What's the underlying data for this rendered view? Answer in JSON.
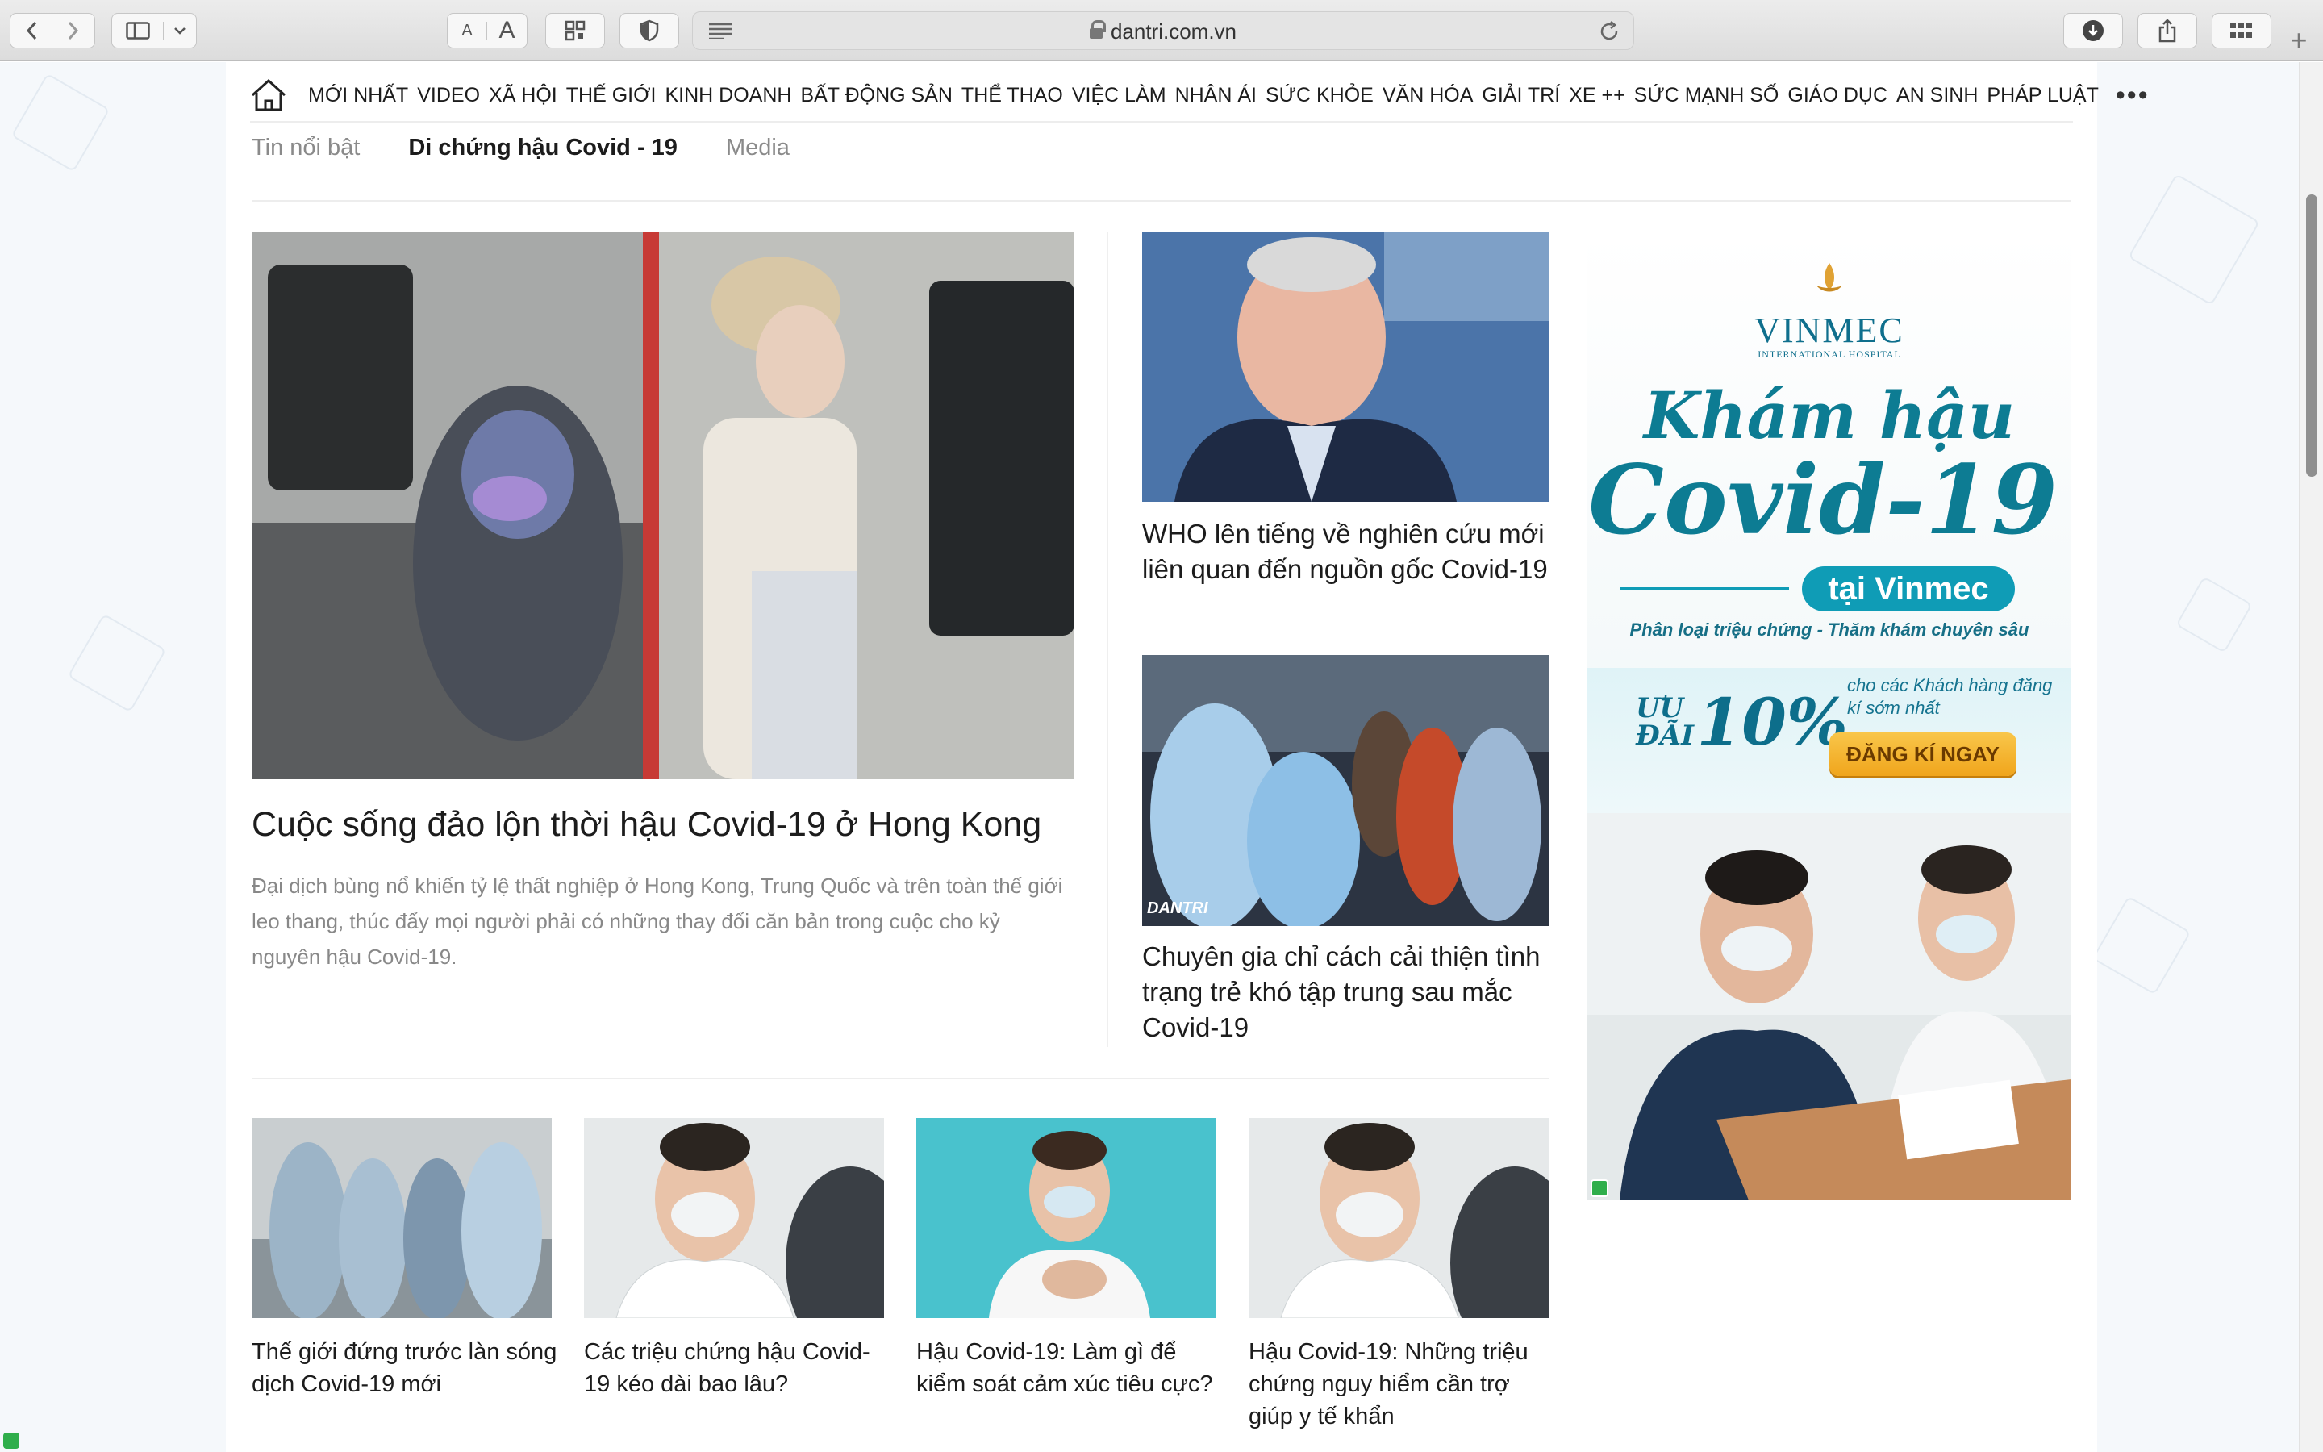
{
  "browser": {
    "url": "dantri.com.vn",
    "text_small": "A",
    "text_large": "A"
  },
  "nav": {
    "items": [
      "MỚI NHẤT",
      "VIDEO",
      "XÃ HỘI",
      "THẾ GIỚI",
      "KINH DOANH",
      "BẤT ĐỘNG SẢN",
      "THỂ THAO",
      "VIỆC LÀM",
      "NHÂN ÁI",
      "SỨC KHỎE",
      "VĂN HÓA",
      "GIẢI TRÍ",
      "XE ++",
      "SỨC MẠNH SỐ",
      "GIÁO DỤC",
      "AN SINH",
      "PHÁP LUẬT"
    ],
    "more": "•••"
  },
  "subtabs": [
    "Tin nổi bật",
    "Di chứng hậu Covid - 19",
    "Media"
  ],
  "feature": {
    "title": "Cuộc sống đảo lộn thời hậu Covid-19 ở Hong Kong",
    "description": "Đại dịch bùng nổ khiến tỷ lệ thất nghiệp ở Hong Kong, Trung Quốc và trên toàn thế giới leo thang, thúc đẩy mọi người phải có những thay đổi căn bản trong cuộc cho kỷ nguyên hậu Covid-19."
  },
  "side_articles": [
    {
      "title": "WHO lên tiếng về nghiên cứu mới liên quan đến nguồn gốc Covid-19"
    },
    {
      "title": "Chuyên gia chỉ cách cải thiện tình trạng trẻ khó tập trung sau mắc Covid-19",
      "watermark": "DANTRI"
    }
  ],
  "cards": [
    {
      "title": "Thế giới đứng trước làn sóng dịch Covid-19 mới"
    },
    {
      "title": "Các triệu chứng hậu Covid-19 kéo dài bao lâu?"
    },
    {
      "title": "Hậu Covid-19: Làm gì để kiểm soát cảm xúc tiêu cực?"
    },
    {
      "title": "Hậu Covid-19: Những triệu chứng nguy hiểm cần trợ giúp y tế khẩn"
    }
  ],
  "ad": {
    "brand": "VINMEC",
    "brand_sub": "INTERNATIONAL HOSPITAL",
    "headline_1": "Khám hậu",
    "headline_2": "Covid-19",
    "pill": "tại Vinmec",
    "sub": "Phân loại triệu chứng - Thăm khám chuyên sâu",
    "deal_label": "ƯU ĐÃI",
    "deal_value": "10%",
    "note": "cho các Khách hàng đăng kí sớm nhất",
    "cta": "ĐĂNG KÍ NGAY"
  },
  "colors": {
    "accent_teal": "#0d7c93",
    "cta_orange": "#f0a51c"
  }
}
